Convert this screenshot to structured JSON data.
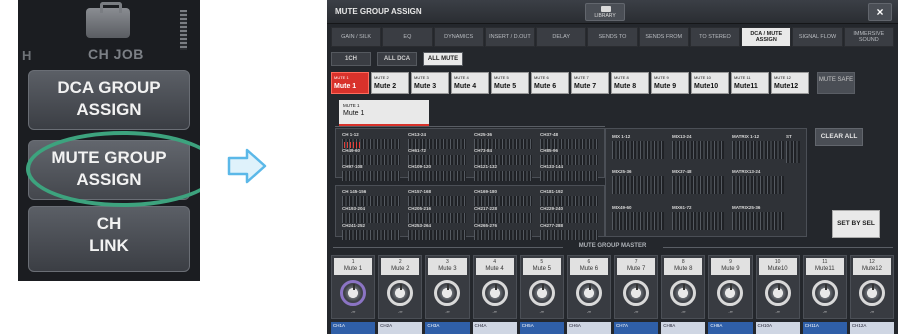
{
  "left_panel": {
    "top_h": "H",
    "top_label": "CH JOB",
    "buttons": [
      {
        "line1": "DCA GROUP",
        "line2": "ASSIGN"
      },
      {
        "line1": "MUTE GROUP",
        "line2": "ASSIGN"
      },
      {
        "line1": "CH",
        "line2": "LINK"
      }
    ],
    "highlight_color": "#3da37e"
  },
  "arrow": {
    "color": "#5bb8e8"
  },
  "window": {
    "title": "MUTE GROUP ASSIGN",
    "library_label": "LIBRARY",
    "close_label": "×",
    "tabs": [
      {
        "label": "GAIN / SILK",
        "active": false
      },
      {
        "label": "EQ",
        "active": false
      },
      {
        "label": "DYNAMICS",
        "active": false
      },
      {
        "label": "INSERT / D.OUT",
        "active": false
      },
      {
        "label": "DELAY",
        "active": false
      },
      {
        "label": "SENDS TO",
        "active": false
      },
      {
        "label": "SENDS FROM",
        "active": false
      },
      {
        "label": "TO STEREO",
        "active": false
      },
      {
        "label": "DCA / MUTE ASSIGN",
        "active": true
      },
      {
        "label": "SIGNAL FLOW",
        "active": false
      },
      {
        "label": "IMMERSIVE SOUND",
        "active": false
      }
    ],
    "modes": [
      "1CH",
      "ALL DCA",
      "ALL MUTE"
    ],
    "active_mode": 2,
    "mute_buttons": [
      {
        "small": "MUTE 1",
        "name": "Mute 1"
      },
      {
        "small": "MUTE 2",
        "name": "Mute 2"
      },
      {
        "small": "MUTE 3",
        "name": "Mute 3"
      },
      {
        "small": "MUTE 4",
        "name": "Mute 4"
      },
      {
        "small": "MUTE 5",
        "name": "Mute 5"
      },
      {
        "small": "MUTE 6",
        "name": "Mute 6"
      },
      {
        "small": "MUTE 7",
        "name": "Mute 7"
      },
      {
        "small": "MUTE 8",
        "name": "Mute 8"
      },
      {
        "small": "MUTE 9",
        "name": "Mute 9"
      },
      {
        "small": "MUTE 10",
        "name": "Mute10"
      },
      {
        "small": "MUTE 11",
        "name": "Mute11"
      },
      {
        "small": "MUTE 12",
        "name": "Mute12"
      }
    ],
    "selected_mute": 0,
    "mute_safe_label": "MUTE SAFE",
    "selected_panel": {
      "small": "MUTE 1",
      "name": "Mute 1"
    },
    "input_groups_a": [
      "CH 1-12",
      "CH13-24",
      "CH25-36",
      "CH37-48",
      "CH49-60",
      "CH61-72",
      "CH73-84",
      "CH85-96",
      "CH97-108",
      "CH109-120",
      "CH121-132",
      "CH133-144"
    ],
    "input_groups_b": [
      "CH 145-156",
      "CH157-168",
      "CH169-180",
      "CH181-192",
      "CH193-204",
      "CH205-216",
      "CH217-228",
      "CH229-240",
      "CH241-252",
      "CH253-264",
      "CH265-276",
      "CH277-288"
    ],
    "output_groups": [
      "MIX 1-12",
      "MIX13-24",
      "MATRIX 1-12",
      "ST",
      "MIX25-36",
      "MIX37-48",
      "MATRIX13-24",
      "MIX49-60",
      "MIX61-72",
      "MATRIX25-36"
    ],
    "clear_all_label": "CLEAR ALL",
    "set_by_sel_label": "SET BY SEL",
    "master_title": "MUTE GROUP MASTER",
    "master": [
      {
        "num": "1",
        "name": "Mute 1"
      },
      {
        "num": "2",
        "name": "Mute 2"
      },
      {
        "num": "3",
        "name": "Mute 3"
      },
      {
        "num": "4",
        "name": "Mute 4"
      },
      {
        "num": "5",
        "name": "Mute 5"
      },
      {
        "num": "6",
        "name": "Mute 6"
      },
      {
        "num": "7",
        "name": "Mute 7"
      },
      {
        "num": "8",
        "name": "Mute 8"
      },
      {
        "num": "9",
        "name": "Mute 9"
      },
      {
        "num": "10",
        "name": "Mute10"
      },
      {
        "num": "11",
        "name": "Mute11"
      },
      {
        "num": "12",
        "name": "Mute12"
      }
    ],
    "knob_value": "-∞",
    "channel_strip": [
      "CH1A",
      "CH2A",
      "CH3A",
      "CH4A",
      "CH5A",
      "CH6A",
      "CH7A",
      "CH8A",
      "CH9A",
      "CH10A",
      "CH11A",
      "CH12A"
    ]
  }
}
